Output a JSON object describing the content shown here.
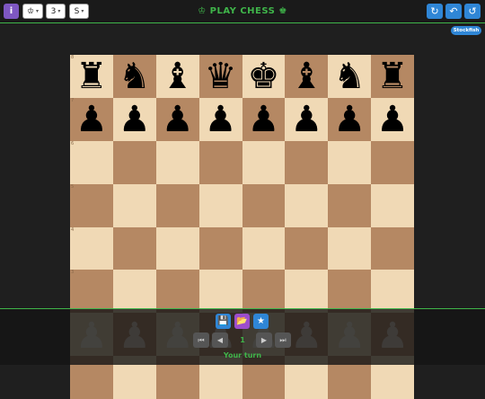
{
  "header": {
    "title": "PLAY CHESS",
    "title_icon_left": "♔",
    "title_icon_right": "♚",
    "info_icon": "info-icon",
    "piece_select": "♔",
    "level_select": "3",
    "size_select": "S",
    "refresh_icon": "↻",
    "undo_icon": "↶",
    "restart_icon": "↺"
  },
  "engine_badge": "Stockfish",
  "board": {
    "rank_labels": [
      "8",
      "7",
      "6",
      "5",
      "4",
      "3"
    ],
    "rank8": [
      "♜",
      "♞",
      "♝",
      "♛",
      "♚",
      "♝",
      "♞",
      "♜"
    ],
    "rank7": [
      "♟",
      "♟",
      "♟",
      "♟",
      "♟",
      "♟",
      "♟",
      "♟"
    ]
  },
  "footer": {
    "save_icon": "💾",
    "load_icon": "📂",
    "star_icon": "★",
    "first_icon": "⏮",
    "prev_icon": "◀",
    "move_number": "1",
    "next_icon": "▶",
    "last_icon": "⏭",
    "status": "Your turn"
  },
  "colors": {
    "accent": "#3fb54a",
    "light_square": "#f0d9b5",
    "dark_square": "#b58863",
    "button_blue": "#2f86d6",
    "button_purple": "#7e57c2"
  }
}
